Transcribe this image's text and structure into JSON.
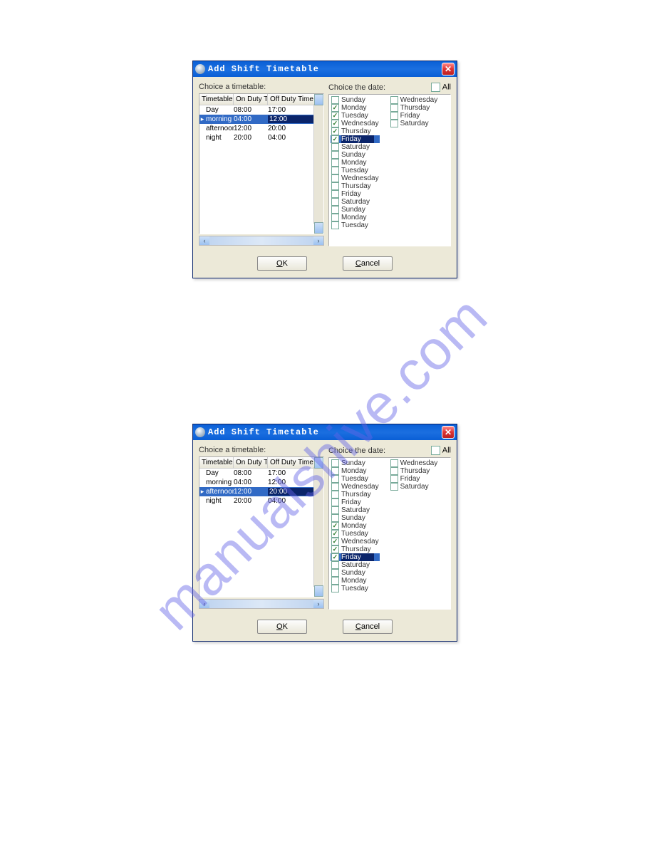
{
  "watermark": "manualshive.com",
  "dialogTitle": "Add Shift Timetable",
  "labels": {
    "choiceTimetable": "Choice a timetable:",
    "choiceDate": "Choice the date:",
    "all": "All"
  },
  "columns": {
    "c1": "Timetable ...",
    "c2": "On Duty Ti...",
    "c3": "Off Duty Time"
  },
  "buttons": {
    "ok": "OK",
    "cancel": "Cancel"
  },
  "dialog1": {
    "rows": [
      {
        "name": "Day",
        "on": "08:00",
        "off": "17:00",
        "selected": false
      },
      {
        "name": "morning",
        "on": "04:00",
        "off": "12:00",
        "selected": true
      },
      {
        "name": "afternoon",
        "on": "12:00",
        "off": "20:00",
        "selected": false
      },
      {
        "name": "night",
        "on": "20:00",
        "off": "04:00",
        "selected": false
      }
    ],
    "datesLeft": [
      {
        "label": "Sunday",
        "checked": false
      },
      {
        "label": "Monday",
        "checked": true
      },
      {
        "label": "Tuesday",
        "checked": true
      },
      {
        "label": "Wednesday",
        "checked": true
      },
      {
        "label": "Thursday",
        "checked": true
      },
      {
        "label": "Friday",
        "checked": true,
        "selected": true
      },
      {
        "label": "Saturday",
        "checked": false
      },
      {
        "label": "Sunday",
        "checked": false
      },
      {
        "label": "Monday",
        "checked": false
      },
      {
        "label": "Tuesday",
        "checked": false
      },
      {
        "label": "Wednesday",
        "checked": false
      },
      {
        "label": "Thursday",
        "checked": false
      },
      {
        "label": "Friday",
        "checked": false
      },
      {
        "label": "Saturday",
        "checked": false
      },
      {
        "label": "Sunday",
        "checked": false
      },
      {
        "label": "Monday",
        "checked": false
      },
      {
        "label": "Tuesday",
        "checked": false
      }
    ],
    "datesRight": [
      {
        "label": "Wednesday",
        "checked": false
      },
      {
        "label": "Thursday",
        "checked": false
      },
      {
        "label": "Friday",
        "checked": false
      },
      {
        "label": "Saturday",
        "checked": false
      }
    ]
  },
  "dialog2": {
    "rows": [
      {
        "name": "Day",
        "on": "08:00",
        "off": "17:00",
        "selected": false
      },
      {
        "name": "morning",
        "on": "04:00",
        "off": "12:00",
        "selected": false
      },
      {
        "name": "afternoon",
        "on": "12:00",
        "off": "20:00",
        "selected": true
      },
      {
        "name": "night",
        "on": "20:00",
        "off": "04:00",
        "selected": false
      }
    ],
    "datesLeft": [
      {
        "label": "Sunday",
        "checked": false
      },
      {
        "label": "Monday",
        "checked": false
      },
      {
        "label": "Tuesday",
        "checked": false
      },
      {
        "label": "Wednesday",
        "checked": false
      },
      {
        "label": "Thursday",
        "checked": false
      },
      {
        "label": "Friday",
        "checked": false
      },
      {
        "label": "Saturday",
        "checked": false
      },
      {
        "label": "Sunday",
        "checked": false
      },
      {
        "label": "Monday",
        "checked": true
      },
      {
        "label": "Tuesday",
        "checked": true
      },
      {
        "label": "Wednesday",
        "checked": true
      },
      {
        "label": "Thursday",
        "checked": true
      },
      {
        "label": "Friday",
        "checked": true,
        "selected": true
      },
      {
        "label": "Saturday",
        "checked": false
      },
      {
        "label": "Sunday",
        "checked": false
      },
      {
        "label": "Monday",
        "checked": false
      },
      {
        "label": "Tuesday",
        "checked": false
      }
    ],
    "datesRight": [
      {
        "label": "Wednesday",
        "checked": false
      },
      {
        "label": "Thursday",
        "checked": false
      },
      {
        "label": "Friday",
        "checked": false
      },
      {
        "label": "Saturday",
        "checked": false
      }
    ]
  }
}
